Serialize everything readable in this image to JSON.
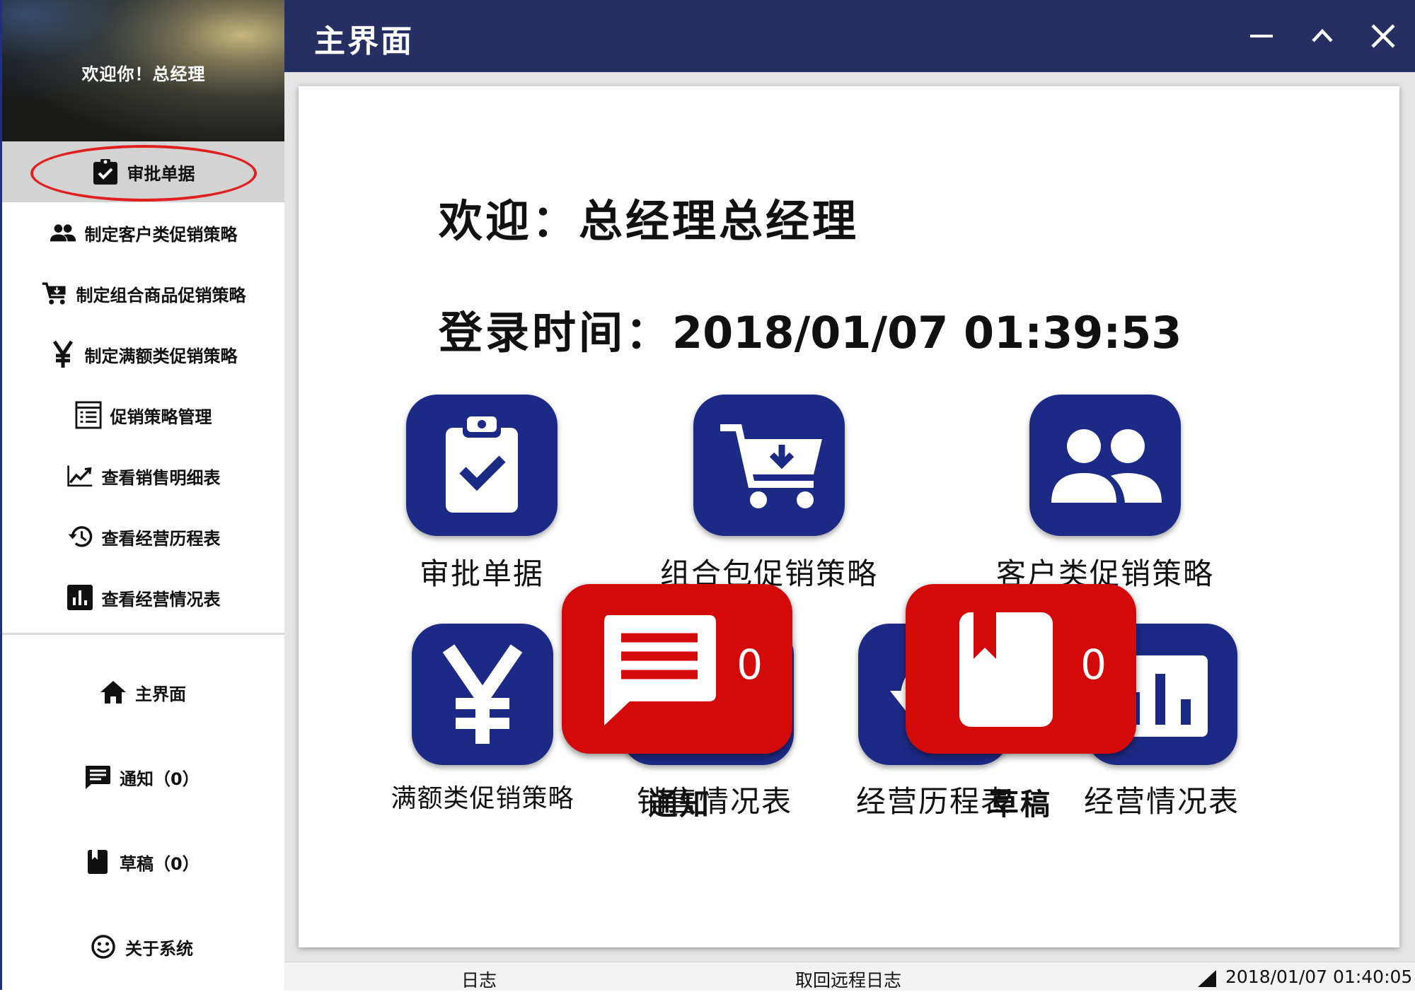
{
  "sidebar": {
    "welcome": "欢迎你！总经理",
    "items": [
      {
        "label": "审批单据",
        "icon": "clipboard-check-icon"
      },
      {
        "label": "制定客户类促销策略",
        "icon": "people-icon"
      },
      {
        "label": "制定组合商品促销策略",
        "icon": "cart-icon"
      },
      {
        "label": "制定满额类促销策略",
        "icon": "yen-icon"
      },
      {
        "label": "促销策略管理",
        "icon": "list-doc-icon"
      },
      {
        "label": "查看销售明细表",
        "icon": "trending-up-icon"
      },
      {
        "label": "查看经营历程表",
        "icon": "history-icon"
      },
      {
        "label": "查看经营情况表",
        "icon": "bar-chart-icon"
      }
    ],
    "bottom": [
      {
        "label": "主界面",
        "icon": "home-icon"
      },
      {
        "label": "通知（0）",
        "icon": "message-icon"
      },
      {
        "label": "草稿（0）",
        "icon": "book-icon"
      },
      {
        "label": "关于系统",
        "icon": "smiley-icon"
      }
    ]
  },
  "titlebar": {
    "title": "主界面",
    "buttons": [
      "minimize-icon",
      "maximize-icon",
      "close-icon"
    ]
  },
  "main": {
    "welcome": "欢迎：总经理总经理",
    "login_label": "登录时间：",
    "login_time": "2018/01/07 01:39:53",
    "tiles": [
      {
        "label": "审批单据",
        "icon": "clipboard-check-icon"
      },
      {
        "label": "组合包促销策略",
        "icon": "cart-download-icon"
      },
      {
        "label": "客户类促销策略",
        "icon": "people-icon"
      },
      {
        "label": "满额类促销策略",
        "icon": "yen-icon"
      },
      {
        "label": "销售情况表",
        "icon": "trending-icon"
      },
      {
        "label": "经营历程表",
        "icon": "history-icon"
      },
      {
        "label": "经营情况表",
        "icon": "bar-chart-icon"
      }
    ],
    "badges": [
      {
        "label": "通知",
        "count": "0",
        "icon": "message-icon"
      },
      {
        "label": "草稿",
        "count": "0",
        "icon": "book-icon"
      }
    ]
  },
  "statusbar": {
    "log": "日志",
    "fetch_log": "取回远程日志",
    "time": "2018/01/07 01:40:05"
  },
  "colors": {
    "titlebar": "#252f62",
    "tile": "#1d2a85",
    "badge": "#d40a0a",
    "active_item": "#d3d3d3"
  }
}
